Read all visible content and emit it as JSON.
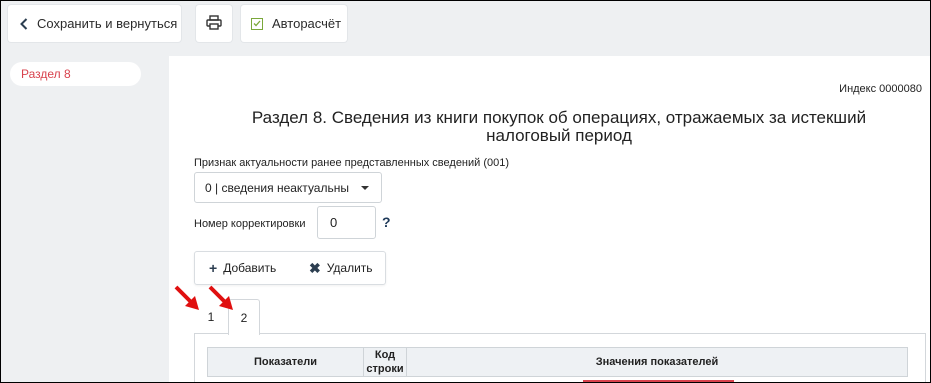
{
  "toolbar": {
    "back_label": "Сохранить и вернуться",
    "auto_calc_label": "Авторасчёт"
  },
  "sidebar": {
    "items": [
      {
        "label": "Раздел 8"
      }
    ]
  },
  "form": {
    "index_label": "Индекс 0000080",
    "title": "Раздел 8. Сведения из книги покупок об операциях, отражаемых за истекший налоговый период",
    "relevance_label": "Признак актуальности ранее представленных сведений (001)",
    "relevance_value": "0 | сведения неактуальны",
    "correction_label": "Номер корректировки",
    "correction_value": "0",
    "help_mark": "?",
    "add_label": "Добавить",
    "delete_label": "Удалить",
    "tabs": [
      {
        "label": "1"
      },
      {
        "label": "2"
      }
    ],
    "table": {
      "headers": [
        "Показатели",
        "Код строки",
        "Значения показателей"
      ]
    }
  },
  "colors": {
    "accent_red": "#d8424d",
    "background": "#eef0f2",
    "check_green": "#7aa83a"
  }
}
